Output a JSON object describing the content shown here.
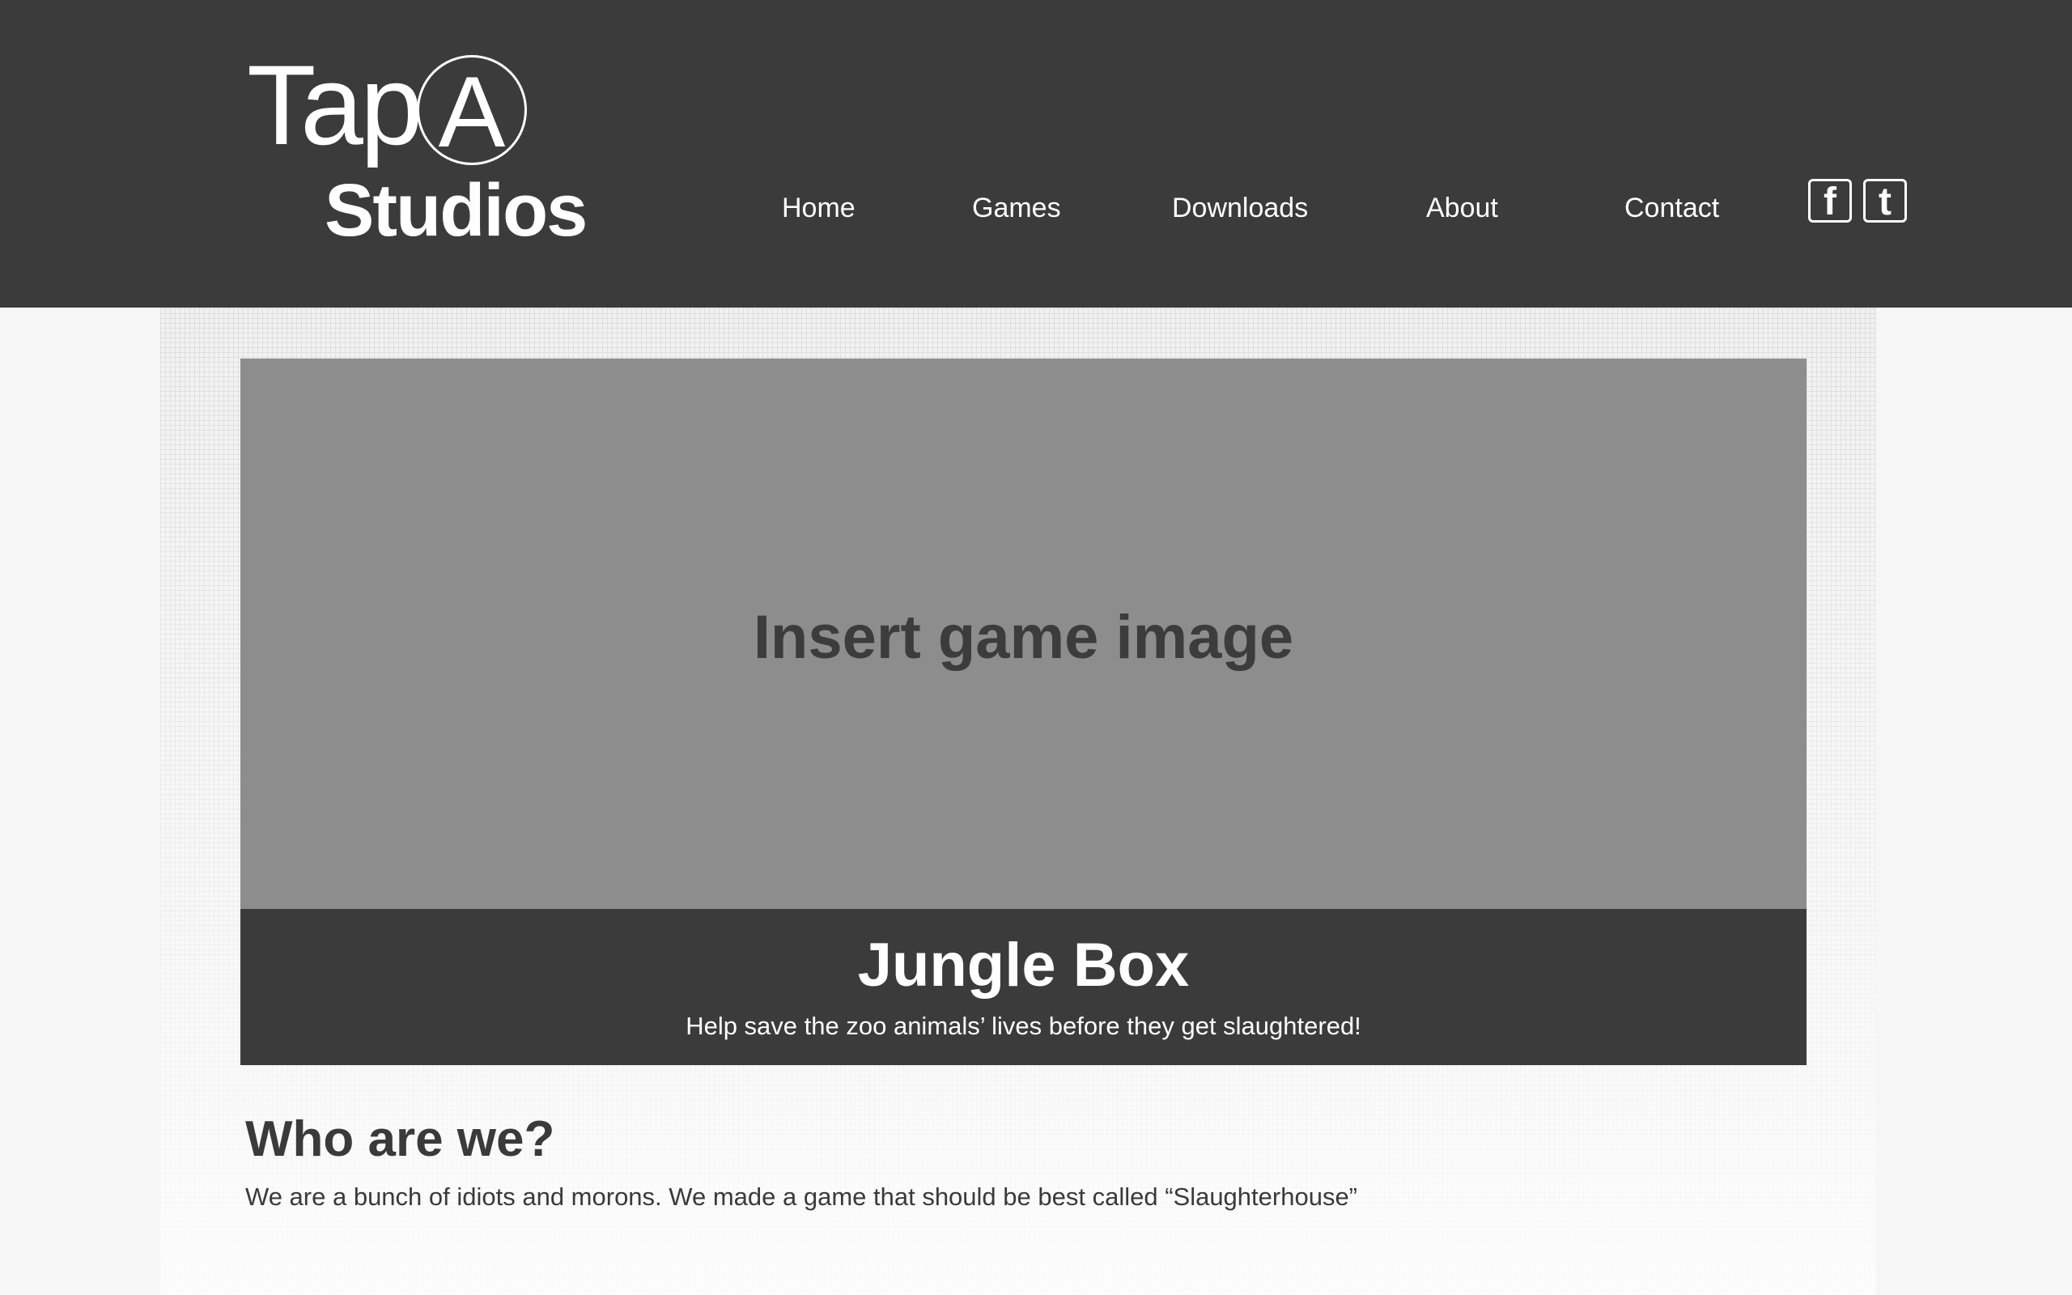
{
  "header": {
    "logo": {
      "line1": "Tap",
      "circled_letter": "A",
      "line2": "Studios"
    },
    "nav": [
      {
        "label": "Home"
      },
      {
        "label": "Games"
      },
      {
        "label": "Downloads"
      },
      {
        "label": "About"
      },
      {
        "label": "Contact"
      }
    ],
    "social": {
      "facebook_icon": "f",
      "twitter_icon": "t"
    }
  },
  "hero": {
    "image_placeholder": "Insert game image",
    "title": "Jungle Box",
    "subtitle": "Help save the zoo animals’ lives before they get slaughtered!"
  },
  "about": {
    "heading": "Who are we?",
    "text": "We are a bunch of idiots and morons. We made a game that should be best called “Slaughterhouse”"
  },
  "colors": {
    "header_bg": "#3b3b3b",
    "image_placeholder_bg": "#8d8d8d",
    "page_bg": "#f6f6f6"
  }
}
